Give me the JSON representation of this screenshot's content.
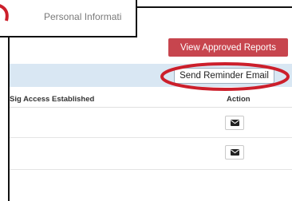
{
  "tab": {
    "label": "Personal Informati"
  },
  "buttons": {
    "approved_reports": "View Approved Reports",
    "send_reminder": "Send Reminder Email"
  },
  "table": {
    "columns": [
      "Sig Access Established",
      "Action"
    ],
    "rows": [
      {
        "action_icon": "envelope-icon"
      },
      {
        "action_icon": "envelope-icon"
      }
    ]
  },
  "colors": {
    "accent_red": "#c7454e",
    "toolbar_blue": "#d9e7f3",
    "highlight_red": "#cc1f2b"
  }
}
